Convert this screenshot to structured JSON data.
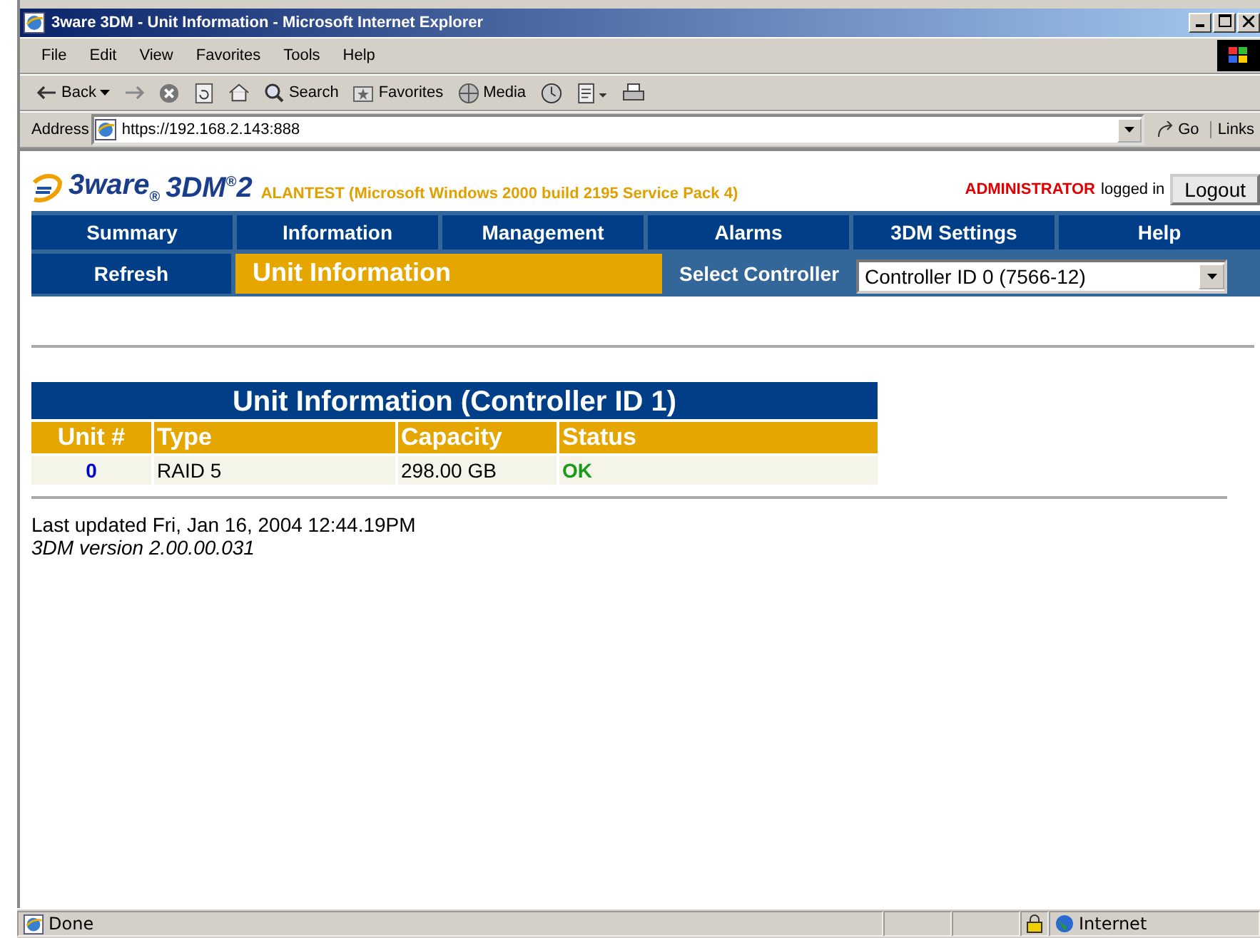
{
  "window": {
    "title": "3ware 3DM - Unit Information - Microsoft Internet Explorer"
  },
  "menu": [
    "File",
    "Edit",
    "View",
    "Favorites",
    "Tools",
    "Help"
  ],
  "toolbar": [
    {
      "kind": "back",
      "label": "Back"
    },
    {
      "kind": "forward"
    },
    {
      "kind": "stop"
    },
    {
      "kind": "refresh"
    },
    {
      "kind": "home"
    },
    {
      "kind": "search",
      "label": "Search"
    },
    {
      "kind": "favorites",
      "label": "Favorites"
    },
    {
      "kind": "media",
      "label": "Media"
    },
    {
      "kind": "history"
    },
    {
      "kind": "edit"
    },
    {
      "kind": "print"
    }
  ],
  "address": {
    "label": "Address",
    "value": "https://192.168.2.143:888",
    "go": "Go",
    "links": "Links"
  },
  "header": {
    "logo_brand": "3ware$_{®}$",
    "logo_product": "3DM$^{®}$2",
    "host": "ALANTEST (Microsoft Windows 2000 build 2195 Service Pack 4)",
    "user": "ADMINISTRATOR",
    "logged_in": "logged in",
    "logout": "Logout"
  },
  "nav": [
    "Summary",
    "Information",
    "Management",
    "Alarms",
    "3DM Settings",
    "Help"
  ],
  "subnav": {
    "refresh": "Refresh",
    "page_title": "Unit Information",
    "select_label": "Select Controller",
    "controller": "Controller ID 0 (7566-12)"
  },
  "unit_table": {
    "title": "Unit Information (Controller ID 1)",
    "columns": [
      "Unit #",
      "Type",
      "Capacity",
      "Status"
    ],
    "rows": [
      {
        "unit": "0",
        "type": "RAID 5",
        "capacity": "298.00 GB",
        "status": "OK"
      }
    ]
  },
  "footer": {
    "last_updated": "Last updated Fri, Jan 16, 2004 12:44.19PM",
    "version": "3DM version 2.00.00.031"
  },
  "status_bar": {
    "text": "Done",
    "zone": "Internet"
  }
}
